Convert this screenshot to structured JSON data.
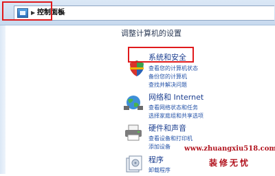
{
  "address_bar": {
    "breadcrumb": "控制面板"
  },
  "main": {
    "heading": "调整计算机的设置",
    "categories": [
      {
        "title": "系统和安全",
        "icon": "shield-icon",
        "links": [
          "查看您的计算机状态",
          "备份您的计算机",
          "查找并解决问题"
        ]
      },
      {
        "title": "网络和 Internet",
        "icon": "network-globe-icon",
        "links": [
          "查看网络状态和任务",
          "选择家庭组和共享选项"
        ]
      },
      {
        "title": "硬件和声音",
        "icon": "printer-icon",
        "links": [
          "查看设备和打印机",
          "添加设备"
        ]
      },
      {
        "title": "程序",
        "icon": "programs-icon",
        "links": [
          "卸载程序"
        ]
      }
    ]
  },
  "watermark": {
    "url": "www.zhuangxiu518.com",
    "text": "装修无忧"
  },
  "colors": {
    "highlight_box": "#e0191b",
    "link": "#2553a8",
    "category_title": "#1a3d8f"
  }
}
